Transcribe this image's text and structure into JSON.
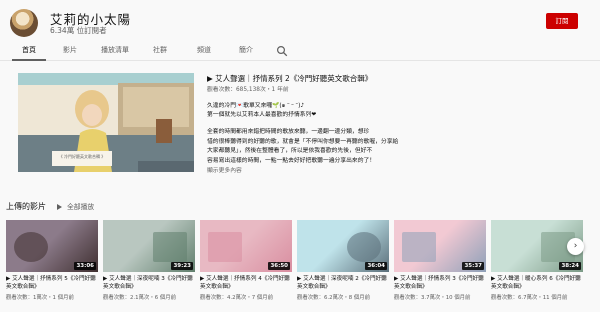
{
  "channel": {
    "name": "艾莉的小太陽",
    "subscribers": "6.34萬 位訂閱者",
    "subscribe_label": "訂閱"
  },
  "tabs": [
    {
      "label": "首頁",
      "active": true
    },
    {
      "label": "影片"
    },
    {
      "label": "播放清單"
    },
    {
      "label": "社群"
    },
    {
      "label": "頻道"
    },
    {
      "label": "簡介"
    }
  ],
  "featured": {
    "title": "▶ 艾人聲選｜抒情系列 2《冷門好聽英文歌合輯》",
    "meta": "觀看次數：685,138次・1 年前",
    "desc1": "久違的冷門💌歌單又來囉🌱(๑ ᵔ ᵕ ᵔ)♪\n第一個就先以艾莉本人最喜歡的抒情系列❤",
    "desc2": "全套的時間都用來錯把時間的歌放來聽，一邊翻一邊分類，想珍\n惜的很棒聽得到的好聽的歌，就會是「不停叫你想要一再聽的歌喔，分享給\n大家都聽見」，然後在整體看了，所以是依我喜歡的先後，但好不\n容易寫出這樣的時間，一點一點去好好把歌聽一遍分享出來的了！",
    "more": "顯示更多內容",
    "thumb_caption": "《 冷門好聽英文歌合輯 》"
  },
  "uploads": {
    "title": "上傳的影片",
    "play_all": "全部播放",
    "videos": [
      {
        "title": "▶ 艾人聲選｜抒情系列 5《冷門好聽英文歌合輯》",
        "duration": "33:06",
        "meta": "觀看次數：1萬次・1 個月前",
        "colors": [
          "#8c7b8a",
          "#3f2f30"
        ]
      },
      {
        "title": "▶ 艾人聲選｜深夜呢喃 3《冷門好聽英文歌合輯》",
        "duration": "39:23",
        "meta": "觀看次數：2.1萬次・6 個月前",
        "colors": [
          "#b9c7c0",
          "#617f6d"
        ]
      },
      {
        "title": "▶ 艾人聲選｜抒情系列 4《冷門好聽英文歌合輯》",
        "duration": "36:50",
        "meta": "觀看次數：4.2萬次・7 個月前",
        "colors": [
          "#e8b9c3",
          "#d98ea0"
        ]
      },
      {
        "title": "▶ 艾人聲選｜深夜呢喃 2《冷門好聽英文歌合輯》",
        "duration": "36:04",
        "meta": "觀看次數：6.2萬次・8 個月前",
        "colors": [
          "#bfe3ea",
          "#5b6f7a"
        ]
      },
      {
        "title": "▶ 艾人聲選｜抒情系列 3《冷門好聽英文歌合輯》",
        "duration": "35:37",
        "meta": "觀看次數：3.7萬次・10 個月前",
        "colors": [
          "#f2c9d3",
          "#8ea0b8"
        ]
      },
      {
        "title": "▶ 艾人聲選｜暖心系列 6《冷門好聽英文歌合輯》",
        "duration": "38:24",
        "meta": "觀看次數：6.7萬次・11 個月前",
        "colors": [
          "#c8dfd5",
          "#7b9a86"
        ]
      }
    ]
  },
  "icons": {
    "search": "search-icon",
    "next": "chevron-right-icon",
    "play_all": "play-icon"
  },
  "colors": {
    "subscribe": "#cc0000",
    "accent": "#606060"
  }
}
